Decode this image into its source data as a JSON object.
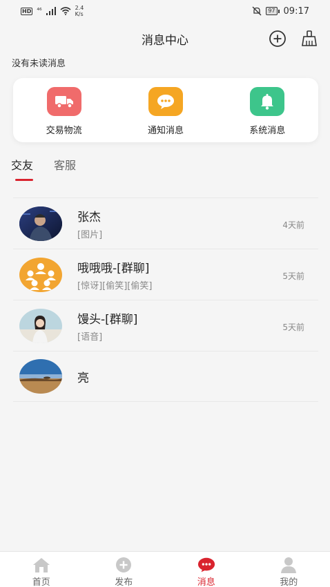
{
  "status_bar": {
    "hd": "HD",
    "signal": "⁴⁶",
    "speed_value": "2.4",
    "speed_unit": "K/s",
    "battery": "97",
    "time": "09:17"
  },
  "header": {
    "title": "消息中心"
  },
  "unread_notice": "没有未读消息",
  "quick_actions": [
    {
      "label": "交易物流",
      "icon": "truck-icon",
      "color": "#f06b6b"
    },
    {
      "label": "通知消息",
      "icon": "chat-bubble-icon",
      "color": "#f5a623"
    },
    {
      "label": "系统消息",
      "icon": "bell-icon",
      "color": "#3dc58b"
    }
  ],
  "tabs": [
    {
      "label": "交友",
      "active": true
    },
    {
      "label": "客服",
      "active": false
    }
  ],
  "chats": [
    {
      "name": "张杰",
      "preview": "[图片]",
      "time": "4天前"
    },
    {
      "name": "哦哦哦-[群聊]",
      "preview": "[惊讶][偷笑][偷笑]",
      "time": "5天前"
    },
    {
      "name": "馒头-[群聊]",
      "preview": "[语音]",
      "time": "5天前"
    },
    {
      "name": "亮",
      "preview": "",
      "time": ""
    }
  ],
  "bottom_nav": [
    {
      "label": "首页",
      "icon": "home-icon",
      "active": false
    },
    {
      "label": "发布",
      "icon": "plus-circle-icon",
      "active": false
    },
    {
      "label": "消息",
      "icon": "message-icon",
      "active": true
    },
    {
      "label": "我的",
      "icon": "profile-icon",
      "active": false
    }
  ],
  "colors": {
    "accent": "#d9232e",
    "background": "#f5f5f5"
  }
}
